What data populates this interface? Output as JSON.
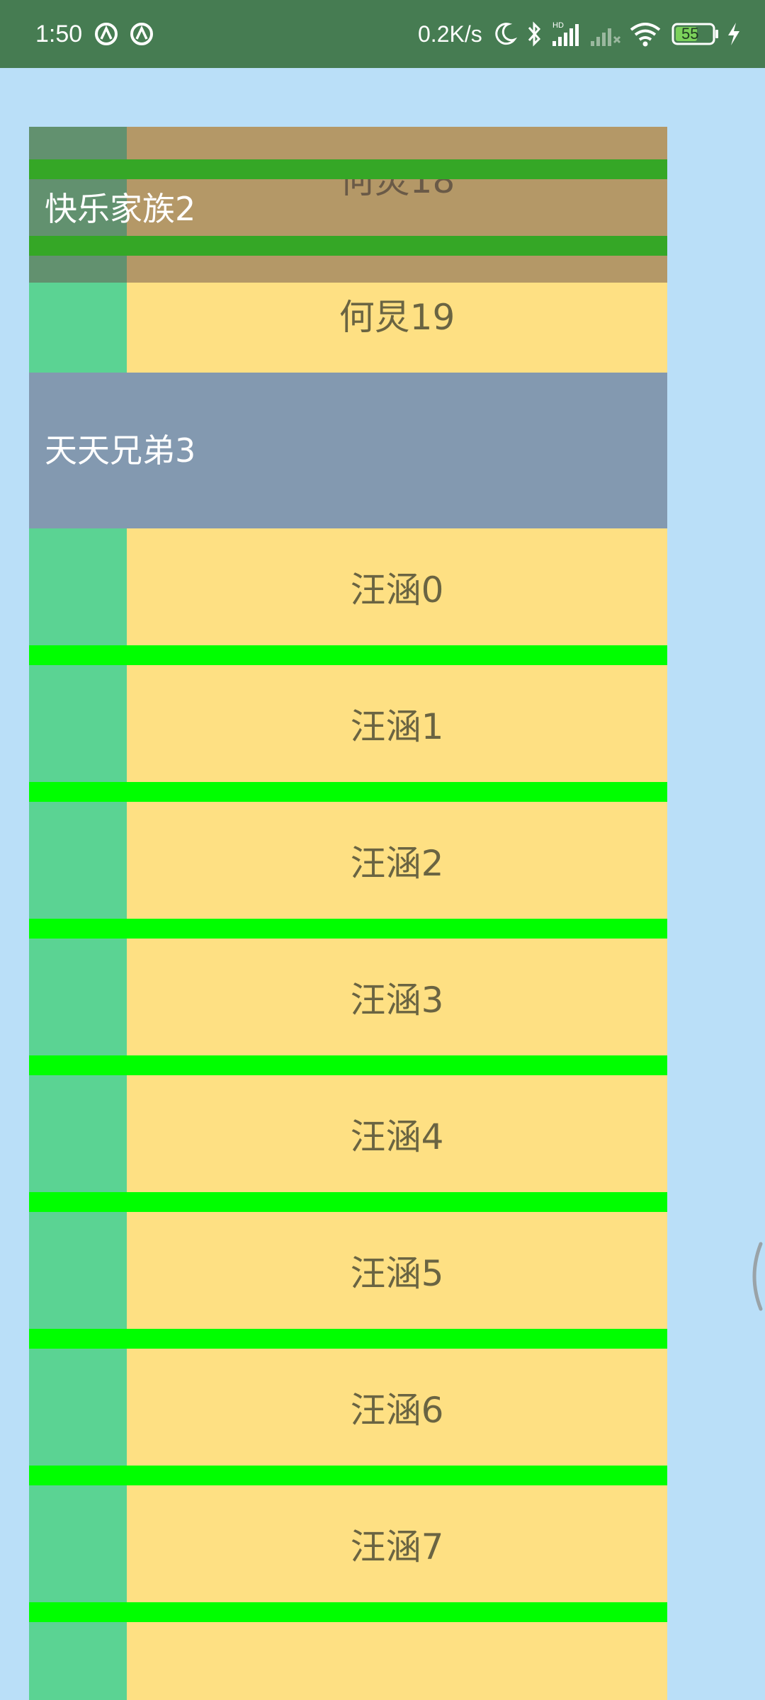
{
  "status_bar": {
    "time": "1:50",
    "network_speed": "0.2K/s",
    "battery_level": "55",
    "icons": [
      "circle-a-icon",
      "circle-a-icon",
      "moon-icon",
      "bluetooth-icon",
      "hd-signal-icon",
      "signal-icon",
      "wifi-icon",
      "battery-icon",
      "charging-bolt-icon"
    ]
  },
  "colors": {
    "status_bar_bg": "#467c52",
    "page_bg": "#badff8",
    "left_cell": "#5bd393",
    "right_cell": "#fee083",
    "divider": "#00ff00",
    "group_header": "#8399b0",
    "item_text": "#6a6442",
    "header_text": "#ffffff"
  },
  "sticky_header": {
    "label": "快乐家族2"
  },
  "list": {
    "rows": [
      {
        "type": "item",
        "label": "何炅18"
      },
      {
        "type": "item",
        "label": "何炅19"
      },
      {
        "type": "header",
        "label": "天天兄弟3"
      },
      {
        "type": "item",
        "label": "汪涵0"
      },
      {
        "type": "item",
        "label": "汪涵1"
      },
      {
        "type": "item",
        "label": "汪涵2"
      },
      {
        "type": "item",
        "label": "汪涵3"
      },
      {
        "type": "item",
        "label": "汪涵4"
      },
      {
        "type": "item",
        "label": "汪涵5"
      },
      {
        "type": "item",
        "label": "汪涵6"
      },
      {
        "type": "item",
        "label": "汪涵7"
      },
      {
        "type": "item",
        "label": ""
      }
    ]
  }
}
